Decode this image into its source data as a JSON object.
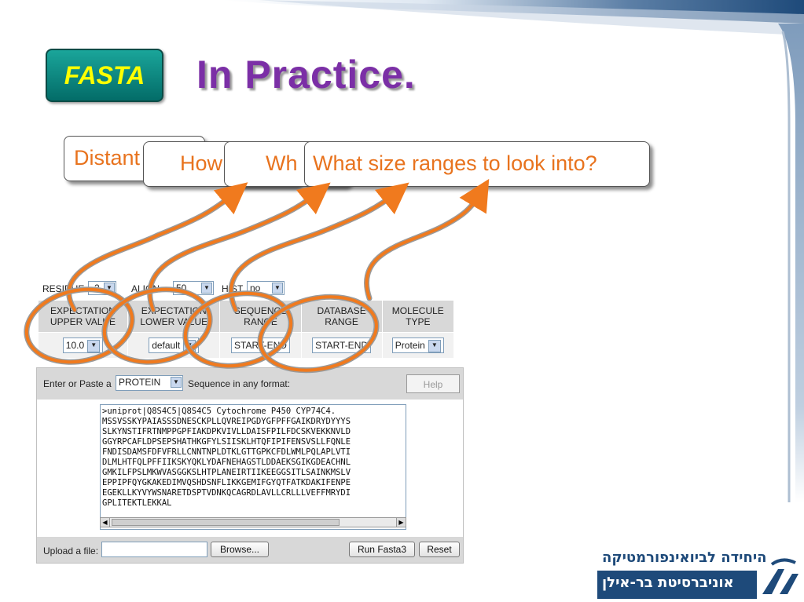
{
  "slide": {
    "badge": "FASTA",
    "title": "In Practice."
  },
  "callouts": [
    {
      "text": "Distant"
    },
    {
      "text": "How"
    },
    {
      "text": "Wh"
    },
    {
      "text": "What size ranges to look into?"
    }
  ],
  "form": {
    "options": {
      "residue_label": "RESIDUE",
      "residue_value": "-2",
      "align_label": "ALIGN",
      "align_value": "50",
      "hist_label": "HIST",
      "hist_value": "no"
    },
    "columns": [
      {
        "header_line1": "EXPECTATION",
        "header_line2": "UPPER VALUE",
        "value": "10.0",
        "control": "select"
      },
      {
        "header_line1": "EXPECTATION",
        "header_line2": "LOWER VALUE",
        "value": "default",
        "control": "select"
      },
      {
        "header_line1": "SEQUENCE",
        "header_line2": "RANGE",
        "value": "START-END",
        "control": "text"
      },
      {
        "header_line1": "DATABASE",
        "header_line2": "RANGE",
        "value": "START-END",
        "control": "text"
      },
      {
        "header_line1": "MOLECULE",
        "header_line2": "TYPE",
        "value": "Protein",
        "control": "select"
      }
    ],
    "seq_prompt_prefix": "Enter or Paste a",
    "seq_type": "PROTEIN",
    "seq_prompt_suffix": "Sequence in any format:",
    "help_label": "Help",
    "sequence_lines": [
      ">uniprot|Q8S4C5|Q8S4C5 Cytochrome P450 CYP74C4.",
      "MSSVSSKYPAIASSSDNESCKPLLQVREIPGDYGFPFFGAIKDRYDYYYS",
      "SLKYNSTIFRTNMPPGPFIAKDPKVIVLLDAISFPILFDCSKVEKKNVLD",
      "GGYRPCAFLDPSEPSHATHKGFYLSIISKLHTQFIPIFENSVSLLFQNLE",
      "FNDISDAMSFDFVFRLLCNNTNPLDTKLGTTGPKCFDLWMLPQLAPLVTI",
      "DLMLHTFQLPFFIIKSKYQKLYDAFNEHAGSTLDDAEKSGIKGDEACHNL",
      "GMKILFPSLMKWVASGGKSLHTPLANEIRTIIKEEGGSITLSAINKMSLV",
      "EPPIPFQYGKAKEDIMVQSHDSNFLIKKGEMIFGYQTFATKDAKIFENPE",
      "EGEKLLKYVYWSNARETDSPTVDNKQCAGRDLAVLLCRLLLVEFFMRYDI",
      "GPLITEKTLEKKAL"
    ],
    "upload_label": "Upload a file:",
    "browse_label": "Browse...",
    "run_label": "Run Fasta3",
    "reset_label": "Reset"
  },
  "logo": {
    "line1": "היחידה לביואינפורמטיקה",
    "line2": "אוניברסיטת בר-אילן"
  },
  "colors": {
    "title": "#7b2fa6",
    "badge_text": "#ffff00",
    "callout_text": "#e8731e",
    "arrow": "#f07a1e",
    "loop_grey": "#9a9a9a",
    "logo_blue": "#1e4a7a",
    "header_bar": "#1e4a7a"
  },
  "icons": {
    "dropdown": "chevron-down-icon",
    "curly_arrow": "curved-arrow-icon",
    "logo": "bar-ilan-logo-icon"
  }
}
